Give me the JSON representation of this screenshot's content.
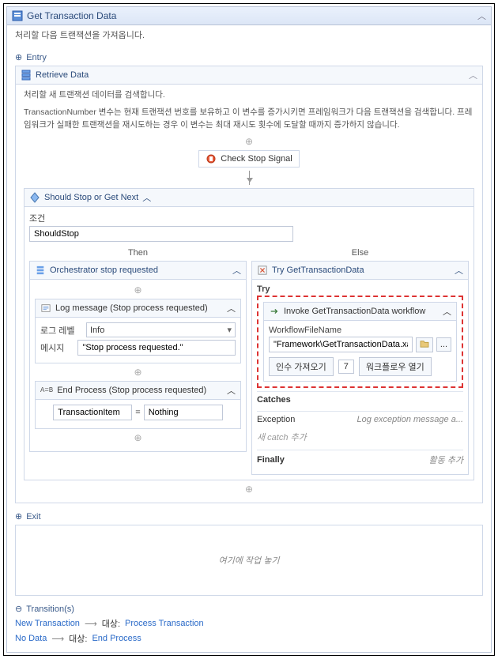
{
  "title": "Get Transaction Data",
  "subtitle": "처리할 다음 트랜잭션을 가져옵니다.",
  "entry": "Entry",
  "retrieve": {
    "title": "Retrieve Data",
    "desc1": "처리할 새 트랜잭션 데이터를 검색합니다.",
    "desc2": "TransactionNumber 변수는 현재 트랜잭션 번호를 보유하고 이 변수를 증가시키면 프레임워크가 다음 트랜잭션을 검색합니다. 프레임워크가 실패한 트랜잭션을 재시도하는 경우 이 변수는 최대 재시도 횟수에 도달할 때까지 증가하지 않습니다."
  },
  "checkStop": "Check Stop Signal",
  "condition": {
    "title": "Should Stop or Get Next",
    "condLabel": "조건",
    "condValue": "ShouldStop",
    "thenLabel": "Then",
    "elseLabel": "Else"
  },
  "then": {
    "title": "Orchestrator stop requested",
    "log": {
      "title": "Log message (Stop process requested)",
      "levelLabel": "로그 레벨",
      "levelValue": "Info",
      "msgLabel": "메시지",
      "msgValue": "\"Stop process requested.\""
    },
    "end": {
      "title": "End Process (Stop process requested)",
      "leftValue": "TransactionItem",
      "eq": "=",
      "rightValue": "Nothing"
    }
  },
  "else": {
    "title": "Try GetTransactionData",
    "tryLabel": "Try",
    "invoke": {
      "title": "Invoke GetTransactionData workflow",
      "fileLabel": "WorkflowFileName",
      "fileValue": "\"Framework\\GetTransactionData.xaml\"",
      "openBtn": "...",
      "importBtn": "인수 가져오기",
      "importCount": "7",
      "openWfBtn": "워크플로우 열기"
    },
    "catches": {
      "label": "Catches",
      "exception": "Exception",
      "excDesc": "Log exception message a...",
      "addCatch": "새 catch 추가"
    },
    "finally": {
      "label": "Finally",
      "desc": "활동 추가"
    }
  },
  "exit": "Exit",
  "dropHint": "여기에 작업 놓기",
  "trans": {
    "title": "Transition(s)",
    "rows": [
      {
        "name": "New Transaction",
        "target": "Process Transaction"
      },
      {
        "name": "No Data",
        "target": "End Process"
      }
    ],
    "targetLabel": "대상:"
  }
}
